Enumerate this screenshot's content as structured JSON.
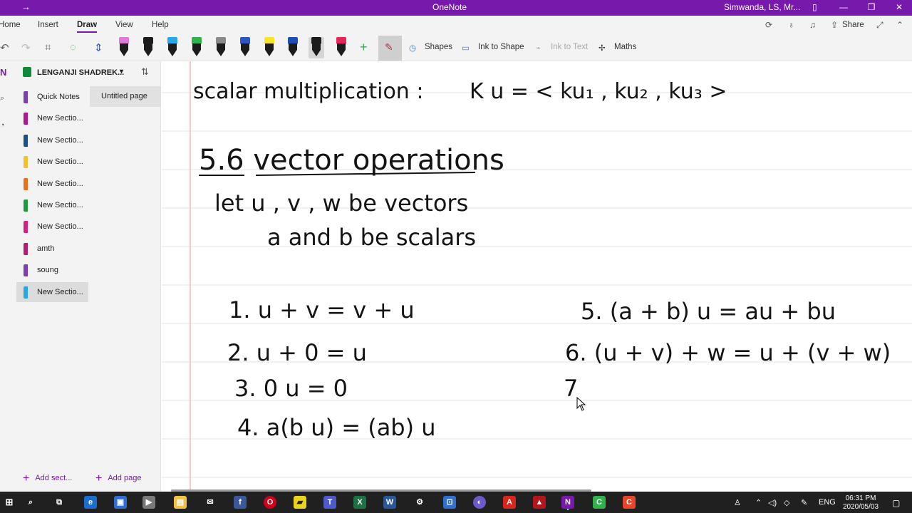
{
  "window": {
    "back_arrow": "→",
    "title": "OneNote",
    "user": "Simwanda, LS, Mr...",
    "minimize": "—",
    "maximize": "❐",
    "close": "✕"
  },
  "ribbon_tabs": [
    {
      "label": "Home"
    },
    {
      "label": "Insert"
    },
    {
      "label": "Draw"
    },
    {
      "label": "View"
    },
    {
      "label": "Help"
    }
  ],
  "active_tab": "Draw",
  "share_label": "Share",
  "toolbar": {
    "pens": [
      {
        "cap": "#e07ad6"
      },
      {
        "cap": "#1c1c1c"
      },
      {
        "cap": "#2aa7e8"
      },
      {
        "cap": "#2fb34a"
      },
      {
        "cap": "#8a8a8a"
      },
      {
        "cap": "#2d55c4"
      },
      {
        "cap": "#f5e62a"
      },
      {
        "cap": "#1f4fb5"
      },
      {
        "cap": "#1c1c1c"
      },
      {
        "cap": "#e8245a"
      }
    ],
    "shapes_label": "Shapes",
    "ink_to_shape_label": "Ink to Shape",
    "ink_to_text_label": "Ink to Text",
    "maths_label": "Maths"
  },
  "notebook": {
    "name": "LENGANJI SHADREK..."
  },
  "sections": [
    {
      "label": "Quick Notes",
      "color": "#7b3fb0"
    },
    {
      "label": "New Sectio...",
      "color": "#b0178a"
    },
    {
      "label": "New Sectio...",
      "color": "#1b4f8a"
    },
    {
      "label": "New Sectio...",
      "color": "#f2c12e"
    },
    {
      "label": "New Sectio...",
      "color": "#e8701f"
    },
    {
      "label": "New Sectio...",
      "color": "#1f9a3e"
    },
    {
      "label": "New Sectio...",
      "color": "#d4217c"
    },
    {
      "label": "amth",
      "color": "#b21d6f"
    },
    {
      "label": "soung",
      "color": "#7b3fb0"
    },
    {
      "label": "New Sectio...",
      "color": "#2aa6dd"
    }
  ],
  "pages": [
    {
      "label": "Untitled page"
    }
  ],
  "add_section_label": "Add sect...",
  "add_page_label": "Add page",
  "ink": {
    "line_scalar": "scalar multiplication :",
    "line_ku": "K u  =  < ku₁ , ku₂ , ku₃ >",
    "heading": "5.6 vector operations",
    "let_line": "let  u , v , w  be  vectors",
    "scalars_line": "a and b  be  scalars",
    "rules": [
      "1.  u + v  =  v + u",
      "2.   u + 0  =  u",
      "3.  0 u  =  0",
      "4.  a(b u) =  (ab) u",
      "5.  (a + b) u  =  au + bu",
      "6.  (u + v) + w  =  u +  (v + w)",
      "7"
    ]
  },
  "taskbar": {
    "tray_lang": "ENG",
    "clock_time": "06:31 PM",
    "clock_date": "2020/05/03"
  }
}
